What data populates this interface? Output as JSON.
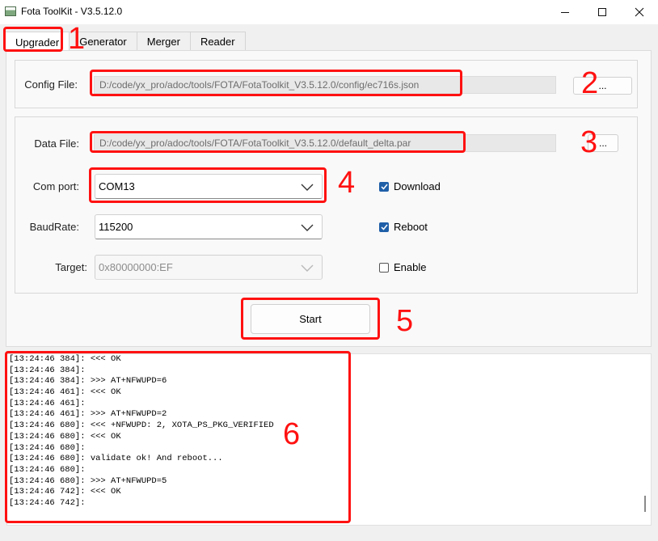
{
  "window": {
    "title": "Fota ToolKit - V3.5.12.0"
  },
  "tabs": [
    "Upgrader",
    "Generator",
    "Merger",
    "Reader"
  ],
  "config": {
    "label": "Config File:",
    "path": "D:/code/yx_pro/adoc/tools/FOTA/FotaToolkit_V3.5.12.0/config/ec716s.json",
    "browse_label": "..."
  },
  "data_file": {
    "label": "Data File:",
    "path": "D:/code/yx_pro/adoc/tools/FOTA/FotaToolkit_V3.5.12.0/default_delta.par",
    "browse_label": "..."
  },
  "com_port": {
    "label": "Com port:",
    "value": "COM13"
  },
  "baud_rate": {
    "label": "BaudRate:",
    "value": "115200"
  },
  "target": {
    "label": "Target:",
    "value": "0x80000000:EF"
  },
  "options": [
    {
      "label": "Download",
      "checked": true
    },
    {
      "label": "Reboot",
      "checked": true
    },
    {
      "label": "Enable",
      "checked": false
    }
  ],
  "start_label": "Start",
  "log_lines": [
    "[13:24:46 384]: <<< OK",
    "[13:24:46 384]:",
    "[13:24:46 384]: >>> AT+NFWUPD=6",
    "[13:24:46 461]: <<< OK",
    "[13:24:46 461]:",
    "[13:24:46 461]: >>> AT+NFWUPD=2",
    "[13:24:46 680]: <<< +NFWUPD: 2, XOTA_PS_PKG_VERIFIED",
    "[13:24:46 680]: <<< OK",
    "[13:24:46 680]:",
    "[13:24:46 680]: validate ok! And reboot...",
    "[13:24:46 680]:",
    "[13:24:46 680]: >>> AT+NFWUPD=5",
    "[13:24:46 742]: <<< OK",
    "[13:24:46 742]:"
  ],
  "annotations": [
    "1",
    "2",
    "3",
    "4",
    "5",
    "6"
  ],
  "colors": {
    "annotation": "#ff1111",
    "checkbox": "#1f5fa8"
  }
}
